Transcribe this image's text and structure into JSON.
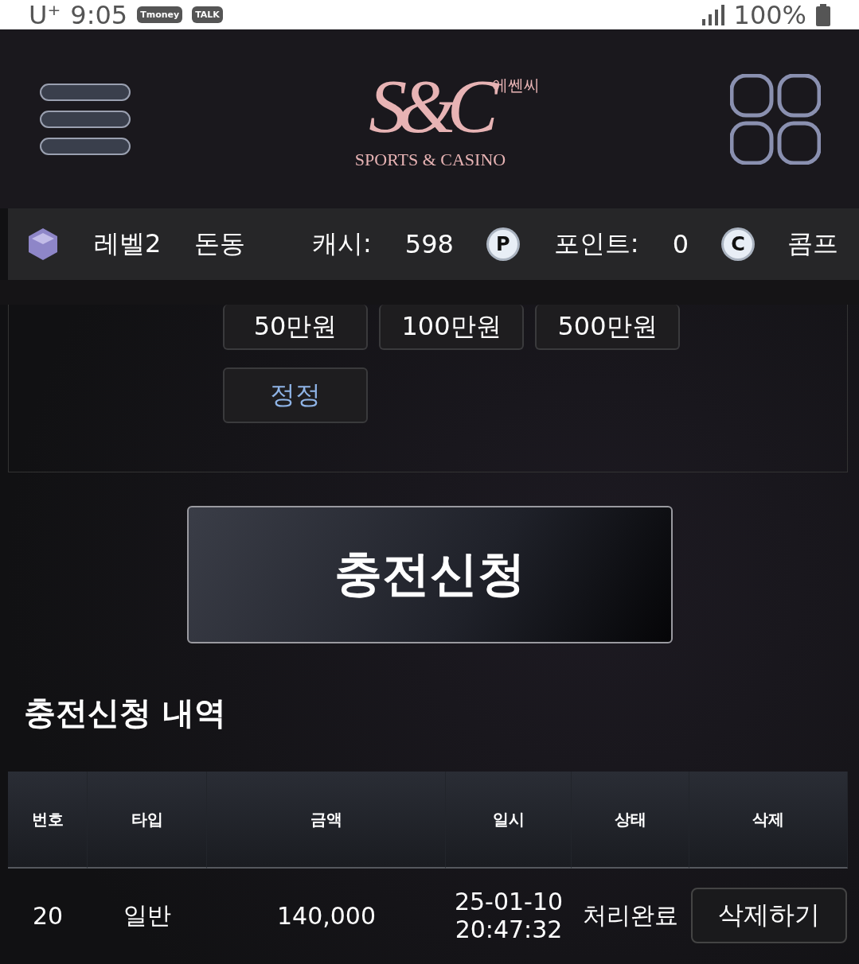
{
  "status_bar": {
    "carrier": "U⁺",
    "time": "9:05",
    "app_icons": [
      "Tmoney",
      "TALK"
    ],
    "battery": "100%"
  },
  "header": {
    "logo": {
      "mark": "S&C",
      "korean": "에쎈씨",
      "tagline": "SPORTS & CASINO"
    }
  },
  "user_bar": {
    "level": "레벨2",
    "nickname": "돈동",
    "cash_label": "캐시:",
    "cash": "598",
    "point_badge": "P",
    "point_label": "포인트:",
    "points": "0",
    "comp_badge": "C",
    "comp_label": "콤프"
  },
  "amount_buttons": [
    {
      "label": "50만원",
      "kind": "amount"
    },
    {
      "label": "100만원",
      "kind": "amount"
    },
    {
      "label": "500만원",
      "kind": "amount"
    },
    {
      "label": "정정",
      "kind": "reset"
    }
  ],
  "submit_button": "충전신청",
  "history": {
    "title": "충전신청 내역",
    "columns": [
      "번호",
      "타입",
      "금액",
      "일시",
      "상태",
      "삭제"
    ],
    "rows": [
      {
        "cells": [
          "20",
          "일반",
          "140,000",
          "25-01-10 20:47:32",
          "처리완료"
        ],
        "action": "삭제하기"
      }
    ]
  }
}
